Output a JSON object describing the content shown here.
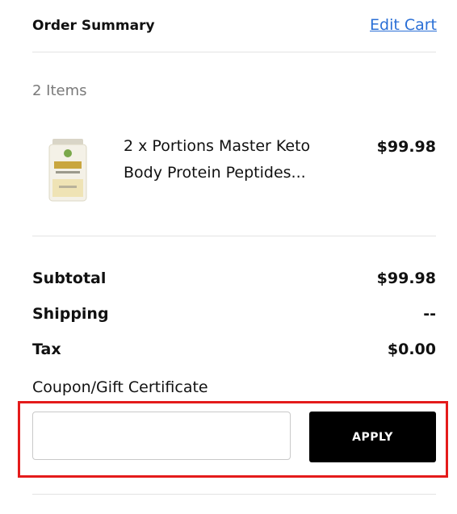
{
  "header": {
    "title": "Order Summary",
    "edit_link": "Edit Cart"
  },
  "cart": {
    "items_count": "2 Items",
    "items": [
      {
        "name": "2 x Portions Master Keto Body Protein Peptides...",
        "price": "$99.98",
        "icon": "product-thumbnail"
      }
    ]
  },
  "totals": {
    "subtotal": {
      "label": "Subtotal",
      "value": "$99.98"
    },
    "shipping": {
      "label": "Shipping",
      "value": "--"
    },
    "tax": {
      "label": "Tax",
      "value": "$0.00"
    }
  },
  "coupon": {
    "label": "Coupon/Gift Certificate",
    "placeholder": "",
    "value": "",
    "apply_label": "APPLY"
  },
  "colors": {
    "link": "#2a6fd6",
    "button_bg": "#000000",
    "highlight": "#e41b1b",
    "divider": "#e3e3e3"
  }
}
